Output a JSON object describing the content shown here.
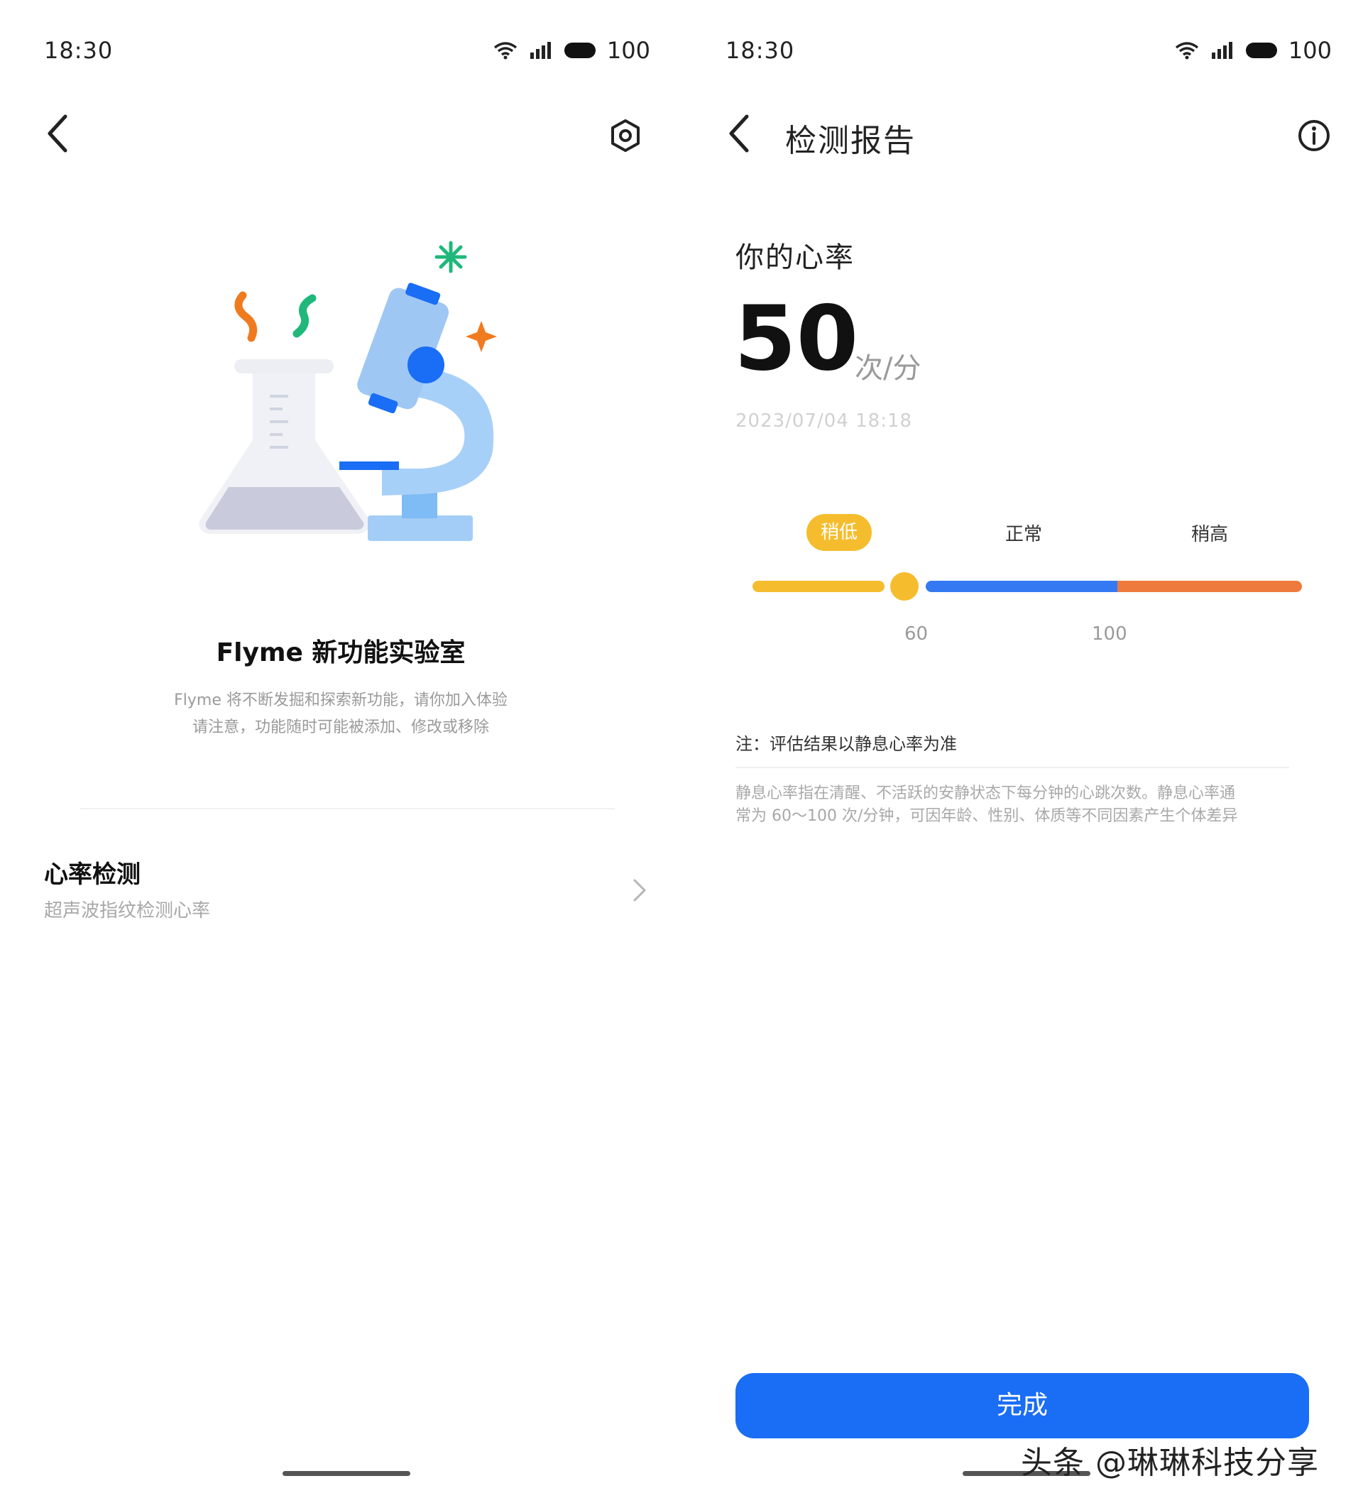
{
  "colors": {
    "accent_blue": "#1a6df5",
    "low_yellow": "#f5bd2d",
    "normal_blue": "#3479f2",
    "high_orange": "#ee7a3e"
  },
  "left_screen": {
    "status_bar": {
      "time": "18:30",
      "battery": "100"
    },
    "icons": {
      "back": "back-arrow-icon",
      "settings": "gear-icon"
    },
    "lab": {
      "title": "Flyme 新功能实验室",
      "desc_line1": "Flyme 将不断发掘和探索新功能，请你加入体验",
      "desc_line2": "请注意，功能随时可能被添加、修改或移除"
    },
    "feature_item": {
      "title": "心率检测",
      "subtitle": "超声波指纹检测心率"
    }
  },
  "right_screen": {
    "status_bar": {
      "time": "18:30",
      "battery": "100"
    },
    "icons": {
      "back": "back-arrow-icon",
      "info": "info-icon"
    },
    "header": {
      "title": "检测报告"
    },
    "report": {
      "label": "你的心率",
      "value": "50",
      "unit": "次/分",
      "timestamp": "2023/07/04  18:18"
    },
    "range": {
      "current_value": 50,
      "labels": {
        "low": "稍低",
        "normal": "正常",
        "high": "稍高"
      },
      "ticks": {
        "t1": "60",
        "t2": "100"
      }
    },
    "note": {
      "title": "注：评估结果以静息心率为准",
      "line1": "静息心率指在清醒、不活跃的安静状态下每分钟的心跳次数。静息心率通",
      "line2": "常为 60～100 次/分钟，可因年龄、性别、体质等不同因素产生个体差异"
    },
    "done_button": "完成"
  },
  "watermark": "头条 @琳琳科技分享"
}
